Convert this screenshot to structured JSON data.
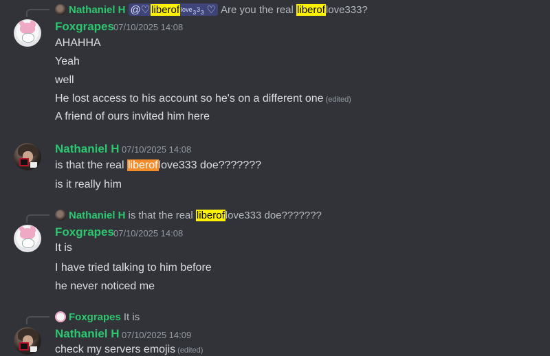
{
  "messages": [
    {
      "reply": {
        "author": "Nathaniel H",
        "mention_prefix": "@♡",
        "mention_highlight": "liberof",
        "mention_love": "love",
        "mention_three_a": "3",
        "mention_three_b": "3",
        "mention_three_c": "3",
        "mention_heart": "♡",
        "text_before": "Are you the real",
        "highlight": "liberof",
        "text_after": "love333?"
      },
      "author": "Foxgrapes",
      "time": "07/10/2025 14:08",
      "lines": [
        "AHAHHA",
        "Yeah",
        "well",
        "He lost access to his account so he's on a different one",
        "A friend of ours invited him here"
      ],
      "edited_label": "(edited)"
    },
    {
      "author": "Nathaniel H",
      "time": "07/10/2025 14:08",
      "line1_before": "is that the real",
      "line1_highlight": "liberof",
      "line1_after": "love333 doe???????",
      "line2": "is it really him"
    },
    {
      "reply": {
        "author": "Nathaniel H",
        "text_before": "is that the real",
        "highlight": "liberof",
        "text_after": "love333 doe???????"
      },
      "author": "Foxgrapes",
      "time": "07/10/2025 14:08",
      "lines": [
        "It is",
        "I have tried talking to him before",
        "he never noticed me"
      ]
    },
    {
      "reply": {
        "author": "Foxgrapes",
        "text": "It is"
      },
      "author": "Nathaniel H",
      "time": "07/10/2025 14:09",
      "line1": "check my servers emojis",
      "edited_label": "(edited)"
    }
  ],
  "colors": {
    "background": "#313338",
    "username": "#2dc770",
    "highlight_yellow": "#fff200",
    "highlight_orange": "#f48c2a"
  }
}
